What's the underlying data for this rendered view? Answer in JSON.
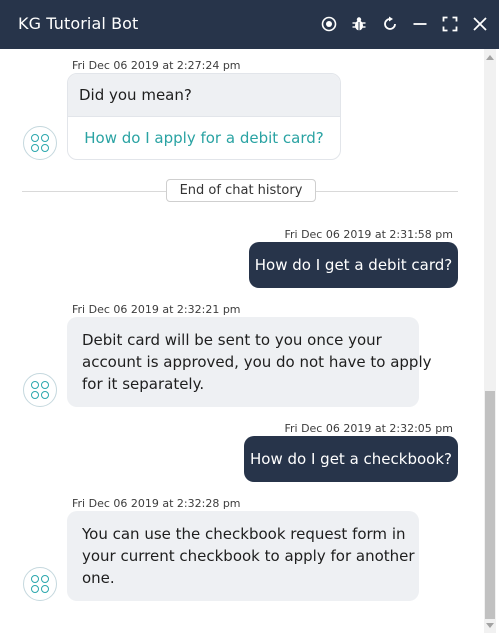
{
  "header": {
    "title": "KG Tutorial Bot",
    "buttons": [
      {
        "name": "record-icon"
      },
      {
        "name": "bug-icon"
      },
      {
        "name": "refresh-icon"
      },
      {
        "name": "minimize-icon"
      },
      {
        "name": "expand-icon"
      },
      {
        "name": "close-icon"
      }
    ]
  },
  "messages": {
    "m1": {
      "timestamp": "Fri Dec 06 2019 at 2:27:24 pm",
      "question": "Did you mean?",
      "suggestion": "How do I apply for a debit card?"
    },
    "history_label": "End of chat history",
    "m2": {
      "timestamp": "Fri Dec 06 2019 at 2:31:58 pm",
      "text": "How do I get a debit card?"
    },
    "m3": {
      "timestamp": "Fri Dec 06 2019 at 2:32:21 pm",
      "lines": [
        "Debit card will be sent to you once your",
        "account is approved, you do not have to apply",
        "for it separately."
      ]
    },
    "m4": {
      "timestamp": "Fri Dec 06 2019 at 2:32:05 pm",
      "text": "How do I get a checkbook?"
    },
    "m5": {
      "timestamp": "Fri Dec 06 2019 at 2:32:28 pm",
      "lines": [
        "You can use the checkbook request form in",
        "your current checkbook to apply for another",
        "one."
      ]
    }
  },
  "colors": {
    "header_bg": "#27344a",
    "user_bubble": "#27344a",
    "bot_bubble": "#eef0f3",
    "accent": "#2aa3a3"
  }
}
